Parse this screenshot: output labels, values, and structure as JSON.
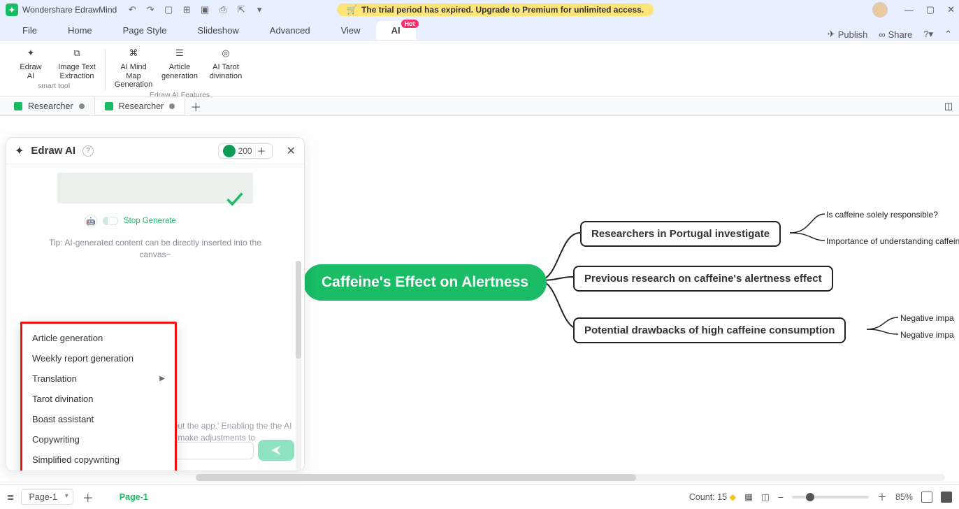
{
  "app": {
    "name": "Wondershare EdrawMind",
    "trial_banner": "The trial period has expired. Upgrade to Premium for unlimited access."
  },
  "menu": {
    "items": [
      "File",
      "Home",
      "Page Style",
      "Slideshow",
      "Advanced",
      "View",
      "AI"
    ],
    "hot": "Hot",
    "publish": "Publish",
    "share": "Share"
  },
  "ribbon": {
    "group1": [
      {
        "l1": "Edraw",
        "l2": "AI"
      },
      {
        "l1": "Image Text",
        "l2": "Extraction"
      }
    ],
    "group1_cap": "smart tool",
    "group2": [
      {
        "l1": "AI Mind Map",
        "l2": "Generation"
      },
      {
        "l1": "Article",
        "l2": "generation"
      },
      {
        "l1": "AI Tarot",
        "l2": "divination"
      }
    ],
    "group2_cap": "Edraw AI Features"
  },
  "tabs": {
    "t1": "Researcher",
    "t2": "Researcher"
  },
  "ai_panel": {
    "title": "Edraw AI",
    "tokens": "200",
    "stop": "Stop Generate",
    "tip": "Tip: AI-generated content can be directly inserted into the canvas~",
    "hint": "bout the app.' Enabling the the AI to make adjustments to",
    "chip": "Article generation"
  },
  "popup": {
    "items": [
      "Article generation",
      "Weekly report generation",
      "Translation",
      "Tarot divination",
      "Boast assistant",
      "Copywriting",
      "Simplified copywriting"
    ]
  },
  "mindmap": {
    "root": "Caffeine's Effect on Alertness",
    "b1": "Researchers in Portugal investigate",
    "b2": "Previous research on caffeine's alertness effect",
    "b3": "Potential drawbacks of high caffeine consumption",
    "l1": "Is caffeine solely responsible?",
    "l2": "Importance of understanding caffeine",
    "l3": "Negative impa",
    "l4": "Negative impa"
  },
  "status": {
    "page_sel": "Page-1",
    "page_lab": "Page-1",
    "count_label": "Count:",
    "count": "15",
    "zoom": "85%"
  }
}
